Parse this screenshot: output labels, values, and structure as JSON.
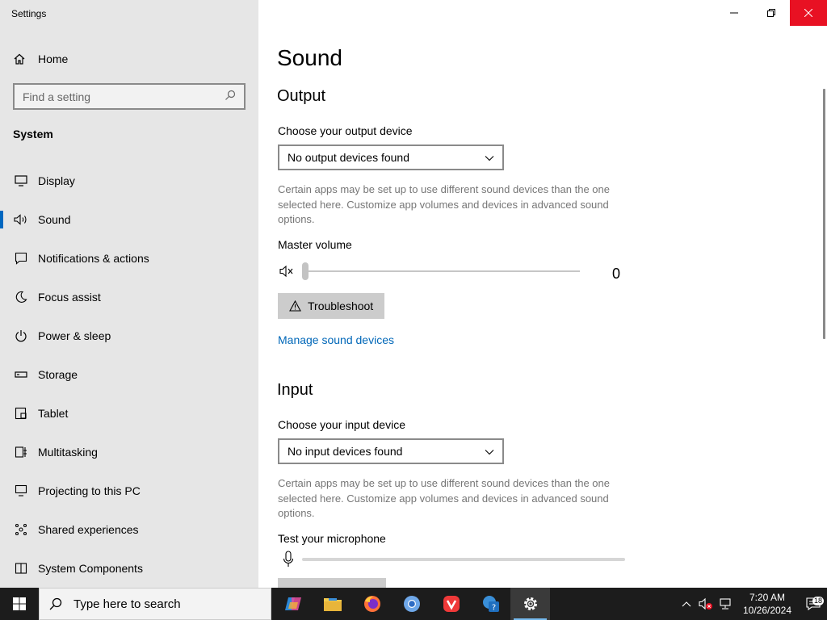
{
  "window": {
    "title": "Settings"
  },
  "sidebar": {
    "home_label": "Home",
    "search_placeholder": "Find a setting",
    "section_label": "System",
    "items": [
      {
        "label": "Display",
        "icon": "monitor-icon"
      },
      {
        "label": "Sound",
        "icon": "speaker-icon",
        "active": true
      },
      {
        "label": "Notifications & actions",
        "icon": "notification-icon"
      },
      {
        "label": "Focus assist",
        "icon": "moon-icon"
      },
      {
        "label": "Power & sleep",
        "icon": "power-icon"
      },
      {
        "label": "Storage",
        "icon": "storage-icon"
      },
      {
        "label": "Tablet",
        "icon": "tablet-icon"
      },
      {
        "label": "Multitasking",
        "icon": "multitasking-icon"
      },
      {
        "label": "Projecting to this PC",
        "icon": "projecting-icon"
      },
      {
        "label": "Shared experiences",
        "icon": "shared-icon"
      },
      {
        "label": "System Components",
        "icon": "components-icon"
      }
    ]
  },
  "main": {
    "title": "Sound",
    "output": {
      "heading": "Output",
      "device_label": "Choose your output device",
      "device_value": "No output devices found",
      "description": "Certain apps may be set up to use different sound devices than the one selected here. Customize app volumes and devices in advanced sound options.",
      "master_volume_label": "Master volume",
      "volume_value": "0",
      "troubleshoot_label": "Troubleshoot",
      "manage_link": "Manage sound devices"
    },
    "input": {
      "heading": "Input",
      "device_label": "Choose your input device",
      "device_value": "No input devices found",
      "description": "Certain apps may be set up to use different sound devices than the one selected here. Customize app volumes and devices in advanced sound options.",
      "test_label": "Test your microphone"
    }
  },
  "taskbar": {
    "search_placeholder": "Type here to search",
    "time": "7:20 AM",
    "date": "10/26/2024",
    "notification_count": "18",
    "accent": "#76b9ed"
  },
  "colors": {
    "accent": "#0067c0",
    "link": "#0067b8",
    "close_red": "#e81123"
  }
}
